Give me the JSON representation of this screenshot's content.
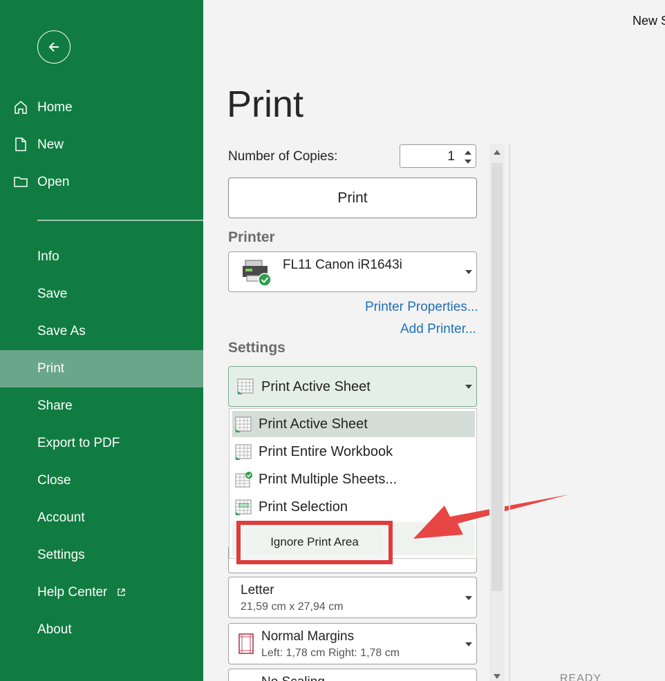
{
  "window": {
    "title": "New S"
  },
  "sidebar": {
    "items": [
      {
        "label": "Home",
        "icon": "home-icon"
      },
      {
        "label": "New",
        "icon": "new-document-icon"
      },
      {
        "label": "Open",
        "icon": "folder-icon"
      },
      {
        "label": "Info"
      },
      {
        "label": "Save"
      },
      {
        "label": "Save As"
      },
      {
        "label": "Print",
        "active": true
      },
      {
        "label": "Share"
      },
      {
        "label": "Export to PDF"
      },
      {
        "label": "Close"
      },
      {
        "label": "Account"
      },
      {
        "label": "Settings"
      },
      {
        "label": "Help Center",
        "icon": "external-link-icon"
      },
      {
        "label": "About"
      }
    ],
    "colors": {
      "background": "#107c41",
      "active": "#6aa68a"
    }
  },
  "main": {
    "title": "Print",
    "copies_label": "Number of Copies:",
    "copies_value": "1",
    "print_button": "Print",
    "printer_heading": "Printer",
    "printer_name": "FL11 Canon iR1643i",
    "printer_properties": "Printer Properties...",
    "add_printer": "Add Printer...",
    "settings_heading": "Settings",
    "settings_selected": "Print Active Sheet",
    "menu_items": [
      {
        "label": "Print Active Sheet",
        "selected": true,
        "icon": "sheet-icon"
      },
      {
        "label": "Print Entire Workbook",
        "icon": "workbook-icon"
      },
      {
        "label": "Print Multiple Sheets...",
        "icon": "multiple-sheets-icon"
      },
      {
        "label": "Print Selection",
        "icon": "selection-icon"
      }
    ],
    "ignore_print_area": "Ignore Print Area",
    "paper": {
      "name": "Letter",
      "size": "21,59 cm x 27,94 cm"
    },
    "margins": {
      "name": "Normal Margins",
      "detail": "Left: 1,78 cm  Right: 1,78 cm"
    },
    "scaling": "No Scaling",
    "status": "READY",
    "annotation_color": "#e03c3c"
  }
}
